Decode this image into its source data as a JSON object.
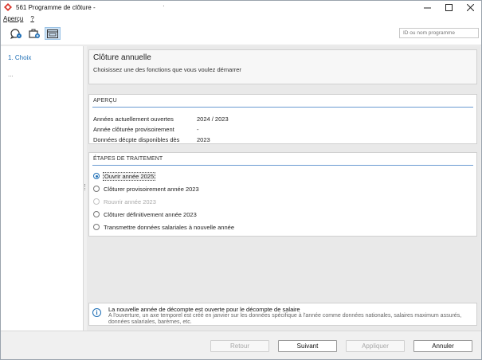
{
  "window": {
    "title": "561 Programme de clôture -",
    "title_dot": "·"
  },
  "menu": [
    {
      "label": "Aperçu"
    },
    {
      "label": "?"
    }
  ],
  "toolbar": {
    "buttons": [
      "chat-refresh-icon",
      "briefcase-add-icon",
      "window-icon"
    ],
    "search_placeholder": "ID ou nom programme"
  },
  "sidebar": {
    "steps": [
      {
        "label": "1. Choix"
      }
    ],
    "more": "..."
  },
  "header": {
    "title": "Clôture annuelle",
    "subtitle": "Choisissez une des fonctions que vous voulez démarrer"
  },
  "overview": {
    "title": "APERÇU",
    "rows": [
      {
        "label": "Années actuellement ouvertes",
        "value": "2024 / 2023"
      },
      {
        "label": "Année clôturée provisoirement",
        "value": "-"
      },
      {
        "label": "Données décpte disponibles dès",
        "value": "2023"
      }
    ]
  },
  "processing": {
    "title": "ÉTAPES DE TRAITEMENT",
    "options": [
      {
        "label": "Ouvrir année 2025",
        "checked": true,
        "disabled": false
      },
      {
        "label": "Clôturer provisoirement année 2023",
        "checked": false,
        "disabled": false
      },
      {
        "label": "Rouvrir année 2023",
        "checked": false,
        "disabled": true
      },
      {
        "label": "Clôturer définitivement année 2023",
        "checked": false,
        "disabled": false
      },
      {
        "label": "Transmettre données salariales à nouvelle année",
        "checked": false,
        "disabled": false
      }
    ]
  },
  "info": {
    "title": "La nouvelle année de décompte est ouverte pour le décompte de salaire",
    "body": "A l'ouverture, un axe temporel est créé en janvier sur les données spécifique à l'année comme données nationales, salaires maximum assurés, données salariales, barèmes, etc."
  },
  "footer": {
    "back": "Retour",
    "next": "Suivant",
    "apply": "Appliquer",
    "cancel": "Annuler"
  },
  "colors": {
    "accent": "#1f6fb6",
    "section_line": "#6a9bd1",
    "app_icon": "#d9342b"
  }
}
